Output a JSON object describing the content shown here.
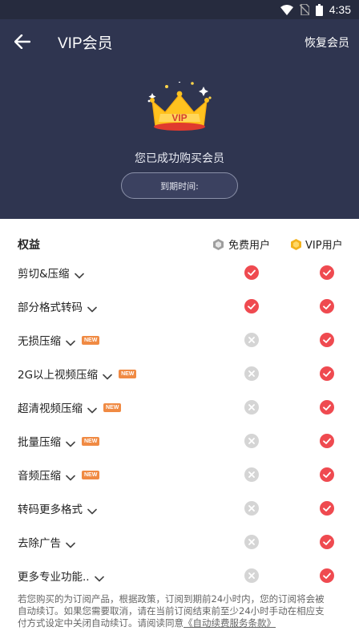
{
  "status_bar": {
    "time": "4:35",
    "icons": [
      "wifi-icon",
      "no-sim-icon",
      "battery-icon"
    ]
  },
  "header": {
    "title": "VIP会员",
    "restore_label": "恢复会员",
    "success_text": "您已成功购买会员",
    "expire_label": "到期时间:",
    "crown_text": "VIP"
  },
  "table": {
    "col_rights": "权益",
    "col_free": "免费用户",
    "col_vip": "VIP用户",
    "new_badge": "NEW",
    "rows": [
      {
        "label": "剪切&压缩",
        "new": false,
        "free": true,
        "vip": true
      },
      {
        "label": "部分格式转码",
        "new": false,
        "free": true,
        "vip": true
      },
      {
        "label": "无损压缩",
        "new": true,
        "free": false,
        "vip": true
      },
      {
        "label": "2G以上视频压缩",
        "new": true,
        "free": false,
        "vip": true
      },
      {
        "label": "超清视频压缩",
        "new": true,
        "free": false,
        "vip": true
      },
      {
        "label": "批量压缩",
        "new": true,
        "free": false,
        "vip": true
      },
      {
        "label": "音频压缩",
        "new": true,
        "free": false,
        "vip": true
      },
      {
        "label": "转码更多格式",
        "new": false,
        "free": false,
        "vip": true
      },
      {
        "label": "去除广告",
        "new": false,
        "free": false,
        "vip": true
      },
      {
        "label": "更多专业功能..",
        "new": false,
        "free": false,
        "vip": true
      }
    ]
  },
  "footer": {
    "line1": "若您购买的为订阅产品，根据政策，订阅到期前24小时内，您的订阅将会被",
    "line2": "自动续订。如果您需要取消，请在当前订阅结束前至少24小时手动在相应支",
    "line3": "付方式设定中关闭自动续订。请阅读同意",
    "link": "《自动续费服务条款》"
  },
  "colors": {
    "header_bg": "#2f3550",
    "check_red": "#ef4a50",
    "cross_grey": "#d5d5d5",
    "new_orange": "#f08a43"
  }
}
